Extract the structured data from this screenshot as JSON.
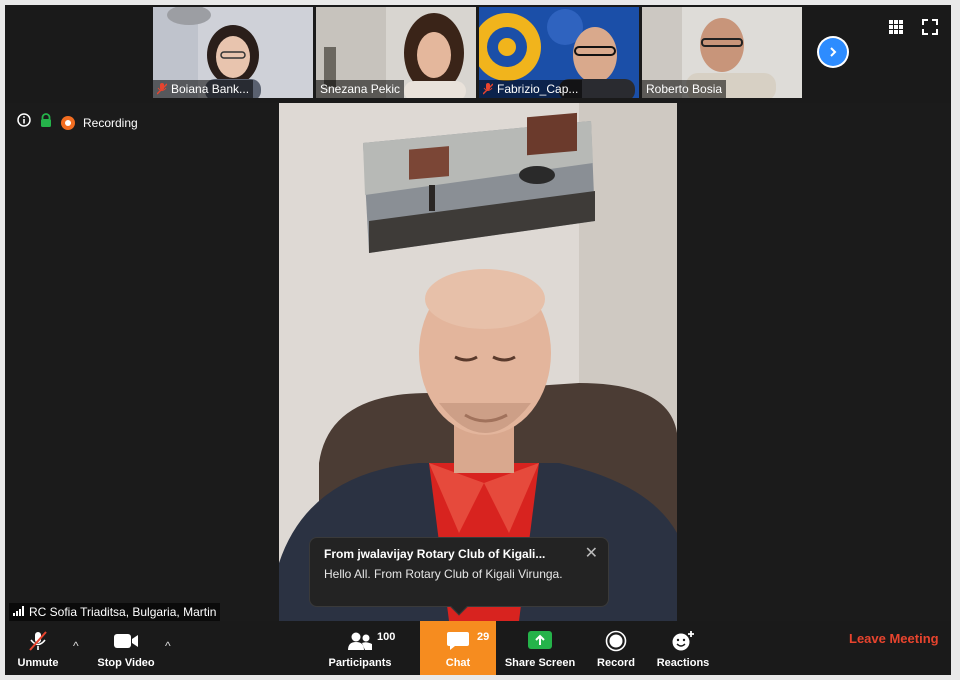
{
  "participants_strip": [
    {
      "name": "Boiana Bank...",
      "muted": true
    },
    {
      "name": "Snezana Pekic",
      "muted": false
    },
    {
      "name": "Fabrizio_Cap...",
      "muted": true
    },
    {
      "name": "Roberto Bosia",
      "muted": false
    }
  ],
  "strip_controls": {
    "next_icon": "chevron-right-icon",
    "grid_icon": "grid-icon",
    "fullscreen_icon": "fullscreen-icon"
  },
  "meeting_info": {
    "recording_label": "Recording"
  },
  "active_speaker": {
    "label": "RC Sofia Triaditsa, Bulgaria, Martin"
  },
  "chat_toast": {
    "title": "From jwalavijay Rotary Club of Kigali...",
    "message": "Hello All. From Rotary Club of Kigali Virunga.",
    "close": "✕"
  },
  "toolbar": {
    "unmute": "Unmute",
    "stop_video": "Stop Video",
    "participants": "Participants",
    "participants_count": "100",
    "chat": "Chat",
    "chat_count": "29",
    "share_screen": "Share Screen",
    "record": "Record",
    "reactions": "Reactions",
    "leave": "Leave Meeting",
    "caret": "^"
  },
  "colors": {
    "chat_active": "#f68c1f",
    "leave": "#e8442e",
    "share_green": "#25b34a",
    "accent_blue": "#2d8cff"
  }
}
